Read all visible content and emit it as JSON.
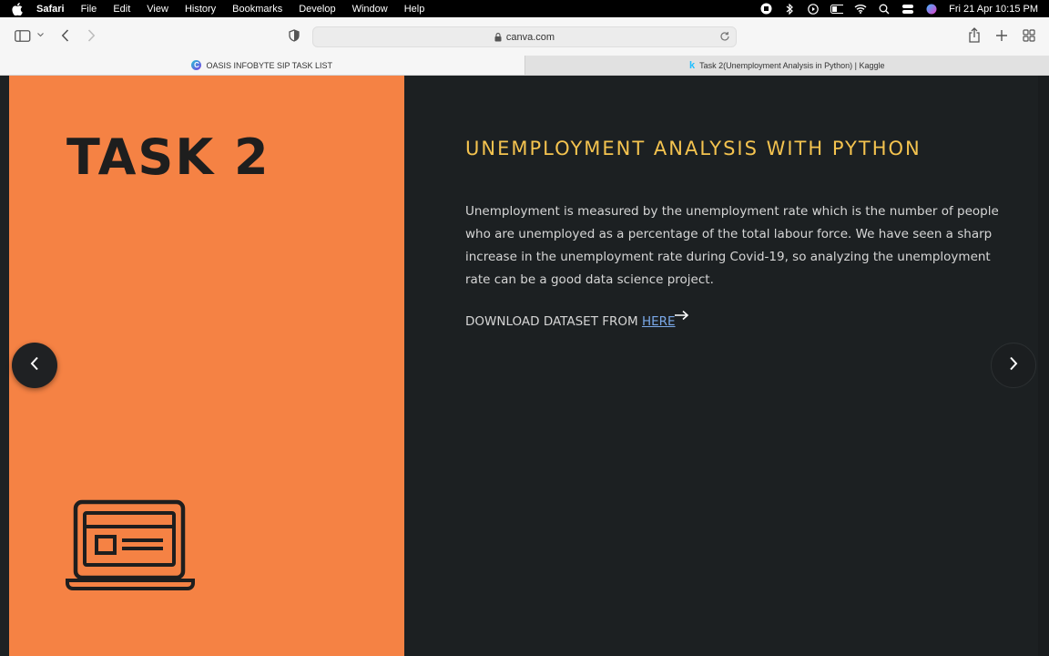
{
  "menubar": {
    "app": "Safari",
    "items": [
      "File",
      "Edit",
      "View",
      "History",
      "Bookmarks",
      "Develop",
      "Window",
      "Help"
    ],
    "clock": "Fri 21 Apr  10:15 PM"
  },
  "toolbar": {
    "address": "canva.com"
  },
  "tabs": [
    {
      "label": "OASIS INFOBYTE SIP TASK LIST",
      "favicon": "canva-icon",
      "active": true
    },
    {
      "label": "Task 2(Unemployment Analysis in Python) | Kaggle",
      "favicon": "kaggle-icon",
      "active": false
    }
  ],
  "slide": {
    "title": "TASK 2",
    "heading": "UNEMPLOYMENT ANALYSIS WITH PYTHON",
    "body": "Unemployment is measured by the unemployment rate which is the number of people who are unemployed as a percentage of the total labour force. We have seen a sharp increase in the unemployment rate during Covid-19, so analyzing the unemployment rate can be a good data science project.",
    "download_prefix": "DOWNLOAD DATASET FROM ",
    "download_link": "HERE",
    "colors": {
      "orange": "#f58244",
      "dark": "#1c2022",
      "heading": "#f4c34f",
      "link": "#7aa8e8"
    }
  }
}
